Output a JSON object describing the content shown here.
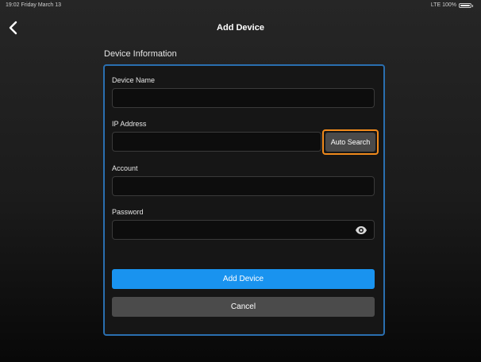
{
  "status_bar": {
    "time_date": "19:02  Friday March 13",
    "network": "LTE",
    "battery_text": "100%",
    "battery_level": 1.0
  },
  "nav": {
    "back_icon": "chevron-left-icon",
    "title": "Add Device"
  },
  "section": {
    "title": "Device Information"
  },
  "form": {
    "device_name": {
      "label": "Device Name",
      "value": "",
      "placeholder": ""
    },
    "ip_address": {
      "label": "IP Address",
      "value": "",
      "placeholder": "",
      "auto_search_label": "Auto Search"
    },
    "account": {
      "label": "Account",
      "value": "",
      "placeholder": ""
    },
    "password": {
      "label": "Password",
      "value": "",
      "placeholder": "",
      "visibility_icon": "eye-icon"
    },
    "submit_label": "Add Device",
    "cancel_label": "Cancel"
  },
  "colors": {
    "accent_blue": "#1993ef",
    "card_border": "#2a6fb0",
    "highlight_orange": "#f08a1c"
  }
}
